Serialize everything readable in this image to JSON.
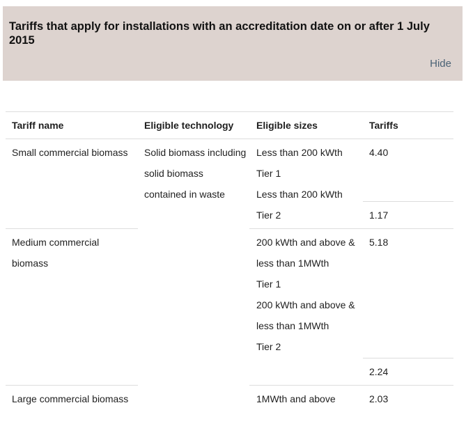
{
  "banner": {
    "title": "Tariffs that apply for installations with an accreditation date on or after 1 July 2015",
    "hide_label": "Hide"
  },
  "table": {
    "headers": [
      "Tariff name",
      "Eligible technology",
      "Eligible sizes",
      "Tariffs"
    ],
    "small": {
      "name": "Small commercial biomass",
      "technology_lines": [
        "Solid biomass including",
        "solid biomass",
        "contained in waste"
      ],
      "tier1_sizes": [
        "Less than 200 kWth",
        "Tier 1",
        "Less than 200 kWth"
      ],
      "tier1_tariff": "4.40",
      "tier2_size": "Tier 2",
      "tier2_tariff": "1.17"
    },
    "medium": {
      "name_lines": [
        "Medium commercial",
        "biomass"
      ],
      "sizes": [
        "200 kWth and above &",
        "less than 1MWth",
        "Tier 1",
        "200 kWth and above &",
        "less than 1MWth",
        "Tier 2"
      ],
      "tier1_tariff": "5.18",
      "tier2_tariff": "2.24"
    },
    "large": {
      "name": "Large commercial biomass",
      "size": "1MWth and above",
      "tariff": "2.03"
    }
  }
}
